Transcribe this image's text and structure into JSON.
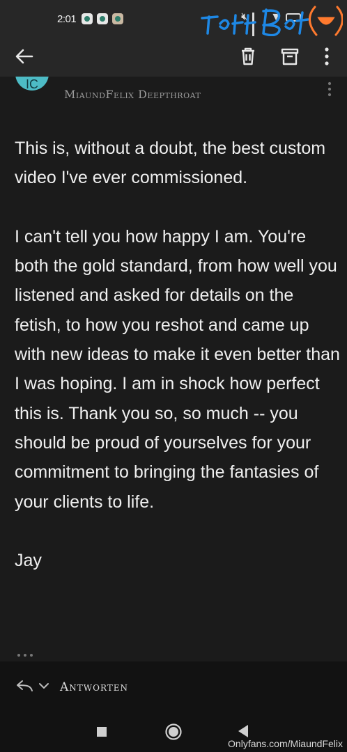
{
  "status_bar": {
    "time": "2:01",
    "icons": [
      "shield-notification-icon",
      "shield-notification-icon",
      "photo-notification-icon",
      "mute-icon",
      "signal-icon",
      "wifi-icon",
      "battery-icon"
    ]
  },
  "app_bar": {
    "back_icon": "arrow-left-icon",
    "actions": [
      "trash-icon",
      "archive-icon",
      "more-vertical-icon"
    ]
  },
  "email": {
    "avatar_initials": "IC",
    "sender": "MiaundFelix Deepthroat",
    "paragraphs": [
      "This is, without a doubt, the best custom video I've ever commissioned.",
      "I can't tell you how happy I am. You're both the gold standard, from how well you listened and asked for details on the fetish, to how you reshot and came up with new ideas to make it even better than I was hoping. I am in shock how perfect this is. Thank you so, so much -- you should be proud of yourselves for your commitment to bringing the fantasies of your clients to life.",
      "Jay"
    ],
    "ellipsis_icon": "more-horizontal-icon"
  },
  "reply_bar": {
    "label": "Antworten"
  },
  "watermark": "Onlyfans.com/MiaundFelix",
  "colors": {
    "avatar": "#4dbbc5",
    "logo_blue": "#1e88e5",
    "logo_orange": "#ff7a2e"
  }
}
